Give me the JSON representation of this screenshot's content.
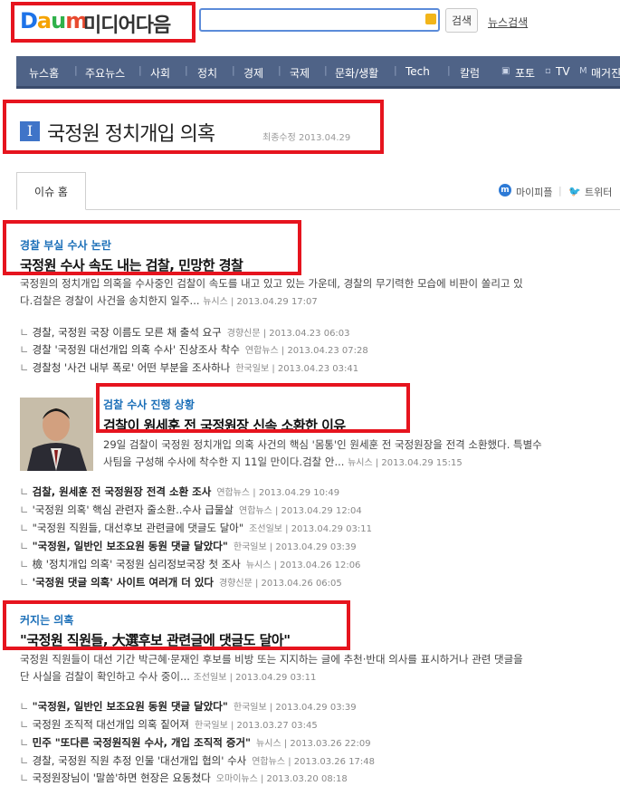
{
  "header": {
    "logo_daum": [
      "D",
      "a",
      "u",
      "m"
    ],
    "logo_text": "미디어다음",
    "search_value": "",
    "search_button": "검색",
    "news_search_link": "뉴스검색"
  },
  "nav": [
    "뉴스홈",
    "주요뉴스",
    "사회",
    "정치",
    "경제",
    "국제",
    "문화/생활",
    "Tech",
    "칼럼",
    "포토",
    "TV",
    "매거진"
  ],
  "issue": {
    "icon_letter": "I",
    "title": "국정원 정치개입 의혹",
    "updated": "최종수정 2013.04.29"
  },
  "tabs": {
    "home": "이슈 홈",
    "mypeople": "마이피플",
    "twitter": "트위터"
  },
  "sections": [
    {
      "kicker": "경찰 부실 수사 논란",
      "headline": "국정원 수사 속도 내는 검찰, 민망한 경찰",
      "summary_line1": "국정원의 정치개입 의혹을 수사중인 검찰이 속도를 내고 있고 있는 가운데, 경찰의 무기력한 모습에 비판이 쏠리고 있",
      "summary_line2": "다.검찰은 경찰이 사건을 송치한지 일주...",
      "source": "뉴시스 | 2013.04.29 17:07",
      "related": [
        {
          "title": "경찰, 국정원 국장 이름도 모른 채 출석 요구",
          "src": "경향신문 | 2013.04.23 06:03",
          "bold": false
        },
        {
          "title": "경찰 '국정원 대선개입 의혹 수사' 진상조사 착수",
          "src": "연합뉴스 | 2013.04.23 07:28",
          "bold": false
        },
        {
          "title": "경찰청 '사건 내부 폭로' 어떤 부분을 조사하나",
          "src": "한국일보 | 2013.04.23 03:41",
          "bold": false
        }
      ]
    },
    {
      "kicker": "검찰 수사 진행 상황",
      "headline": "검찰이 원세훈 전 국정원장 신속 소환한 이유",
      "summary_line1": "29일 검찰이 국정원 정치개입 의혹 사건의 핵심 '몸통'인 원세훈 전 국정원장을 전격 소환했다. 특별수",
      "summary_line2": "사팀을 구성해 수사에 착수한 지 11일 만이다.검찰 안...",
      "source": "뉴시스 | 2013.04.29 15:15",
      "related": [
        {
          "title": "검찰, 원세훈 전 국정원장 전격 소환 조사",
          "src": "연합뉴스 | 2013.04.29 10:49",
          "bold": true
        },
        {
          "title": "'국정원 의혹' 핵심 관련자 줄소환..수사 급물살",
          "src": "연합뉴스 | 2013.04.29 12:04",
          "bold": false
        },
        {
          "title": "\"국정원 직원들, 대선후보 관련글에 댓글도 달아\"",
          "src": "조선일보 | 2013.04.29 03:11",
          "bold": false
        },
        {
          "title": "\"국정원, 일반인 보조요원 동원 댓글 달았다\"",
          "src": "한국일보 | 2013.04.29 03:39",
          "bold": true
        },
        {
          "title": "檢 '정치개입 의혹' 국정원 심리정보국장 첫 조사",
          "src": "뉴시스 | 2013.04.26 12:06",
          "bold": false
        },
        {
          "title": "'국정원 댓글 의혹' 사이트 여러개 더 있다",
          "src": "경향신문 | 2013.04.26 06:05",
          "bold": true
        }
      ]
    },
    {
      "kicker": "커지는 의혹",
      "headline": "\"국정원 직원들, 大選후보 관련글에 댓글도 달아\"",
      "summary_line1": "국정원 직원들이 대선 기간 박근혜·문재인 후보를 비방 또는 지지하는 글에 추천·반대 의사를 표시하거나 관련 댓글을",
      "summary_line2": "단 사실을 검찰이 확인하고 수사 중이...",
      "source": "조선일보 | 2013.04.29 03:11",
      "related": [
        {
          "title": "\"국정원, 일반인 보조요원 동원 댓글 달았다\"",
          "src": "한국일보 | 2013.04.29 03:39",
          "bold": true
        },
        {
          "title": "국정원 조직적 대선개입 의혹 짙어져",
          "src": "한국일보 | 2013.03.27 03:45",
          "bold": false
        },
        {
          "title": "민주 \"또다른 국정원직원 수사, 개입 조직적 증거\"",
          "src": "뉴시스 | 2013.03.26 22:09",
          "bold": true
        },
        {
          "title": "경찰, 국정원 직원 추정 인물 '대선개입 협의' 수사",
          "src": "연합뉴스 | 2013.03.26 17:48",
          "bold": false
        },
        {
          "title": "국정원장님이 '말씀'하면 현장은 요동쳤다",
          "src": "오마이뉴스 | 2013.03.20 08:18",
          "bold": false
        }
      ]
    }
  ],
  "colors": {
    "highlight_box": "#e6141e",
    "nav_bg": "#4f6387",
    "kicker": "#1b6fb8"
  }
}
